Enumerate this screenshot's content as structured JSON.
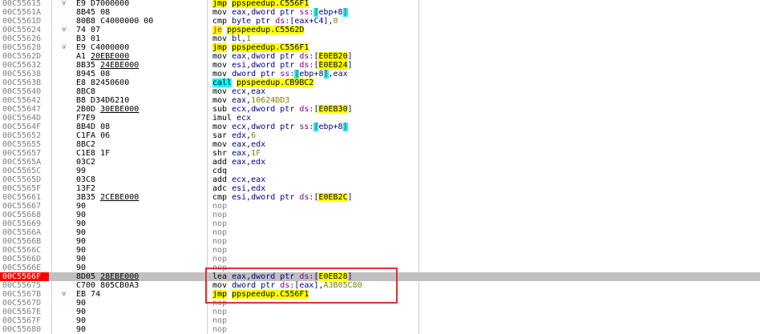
{
  "highlight_color": "#e03030",
  "selected_row_color": "#c0c0c0",
  "rows": [
    {
      "addr": "00C55615",
      "arrow": "v",
      "bytes": [
        {
          "t": "E9 D7000000"
        }
      ],
      "instr": [
        {
          "t": "jmp",
          "c": "mn y"
        },
        {
          "t": " "
        },
        {
          "t": "ppspeedup.C556F1",
          "c": "tgt"
        }
      ]
    },
    {
      "addr": "00C5561A",
      "arrow": "",
      "bytes": [
        {
          "t": "8B45 08"
        }
      ],
      "instr": [
        {
          "t": "mov",
          "c": "mn"
        },
        {
          "t": " eax,dword ptr ",
          "c": "reg"
        },
        {
          "t": "ss:",
          "c": "seg"
        },
        {
          "t": "[",
          "c": "br"
        },
        {
          "t": "ebp+8",
          "c": "reg"
        },
        {
          "t": "]",
          "c": "br"
        }
      ]
    },
    {
      "addr": "00C5561D",
      "arrow": "",
      "bytes": [
        {
          "t": "80B8 C4000000 00"
        }
      ],
      "instr": [
        {
          "t": "cmp",
          "c": "mn"
        },
        {
          "t": " byte ptr ",
          "c": "reg"
        },
        {
          "t": "ds:",
          "c": "seg"
        },
        {
          "t": "[eax+C4]",
          "c": "reg"
        },
        {
          "t": ",",
          "c": "reg"
        },
        {
          "t": "0",
          "c": "imm"
        }
      ]
    },
    {
      "addr": "00C55624",
      "arrow": "v",
      "bytes": [
        {
          "t": "74 07"
        }
      ],
      "instr": [
        {
          "t": "je",
          "c": "mn je"
        },
        {
          "t": " "
        },
        {
          "t": "ppspeedup.C5562D",
          "c": "tgt"
        }
      ]
    },
    {
      "addr": "00C55626",
      "arrow": "",
      "bytes": [
        {
          "t": "B3 01"
        }
      ],
      "instr": [
        {
          "t": "mov",
          "c": "mn"
        },
        {
          "t": " bl,",
          "c": "reg"
        },
        {
          "t": "1",
          "c": "imm"
        }
      ]
    },
    {
      "addr": "00C55628",
      "arrow": "v",
      "bytes": [
        {
          "t": "E9 C4000000"
        }
      ],
      "instr": [
        {
          "t": "jmp",
          "c": "mn y"
        },
        {
          "t": " "
        },
        {
          "t": "ppspeedup.C556F1",
          "c": "tgt"
        }
      ]
    },
    {
      "addr": "00C5562D",
      "arrow": "",
      "bytes": [
        {
          "t": "A1 "
        },
        {
          "t": "20EBE000",
          "c": "u"
        }
      ],
      "instr": [
        {
          "t": "mov",
          "c": "mn"
        },
        {
          "t": " eax,dword ptr ",
          "c": "reg"
        },
        {
          "t": "ds:",
          "c": "seg"
        },
        {
          "t": "[",
          "c": "reg"
        },
        {
          "t": "E0EB20",
          "c": "mem"
        },
        {
          "t": "]",
          "c": "reg"
        }
      ]
    },
    {
      "addr": "00C55632",
      "arrow": "",
      "bytes": [
        {
          "t": "8B35 "
        },
        {
          "t": "24EBE000",
          "c": "u"
        }
      ],
      "instr": [
        {
          "t": "mov",
          "c": "mn"
        },
        {
          "t": " esi,dword ptr ",
          "c": "reg"
        },
        {
          "t": "ds:",
          "c": "seg"
        },
        {
          "t": "[",
          "c": "reg"
        },
        {
          "t": "E0EB24",
          "c": "mem"
        },
        {
          "t": "]",
          "c": "reg"
        }
      ]
    },
    {
      "addr": "00C55638",
      "arrow": "",
      "bytes": [
        {
          "t": "8945 08"
        }
      ],
      "instr": [
        {
          "t": "mov",
          "c": "mn"
        },
        {
          "t": " dword ptr ",
          "c": "reg"
        },
        {
          "t": "ss:",
          "c": "seg"
        },
        {
          "t": "[",
          "c": "br"
        },
        {
          "t": "ebp+8",
          "c": "reg"
        },
        {
          "t": "]",
          "c": "br"
        },
        {
          "t": ",eax",
          "c": "reg"
        }
      ]
    },
    {
      "addr": "00C5563B",
      "arrow": "",
      "bytes": [
        {
          "t": "E8 82450600"
        }
      ],
      "instr": [
        {
          "t": "call",
          "c": "mn c"
        },
        {
          "t": " "
        },
        {
          "t": "ppspeedup.CB9BC2",
          "c": "tgt"
        }
      ]
    },
    {
      "addr": "00C55640",
      "arrow": "",
      "bytes": [
        {
          "t": "8BC8"
        }
      ],
      "instr": [
        {
          "t": "mov",
          "c": "mn"
        },
        {
          "t": " ecx,eax",
          "c": "reg"
        }
      ]
    },
    {
      "addr": "00C55642",
      "arrow": "",
      "bytes": [
        {
          "t": "B8 D34D6210"
        }
      ],
      "instr": [
        {
          "t": "mov",
          "c": "mn"
        },
        {
          "t": " eax,",
          "c": "reg"
        },
        {
          "t": "10624DD3",
          "c": "imm"
        }
      ]
    },
    {
      "addr": "00C55647",
      "arrow": "",
      "bytes": [
        {
          "t": "2B0D "
        },
        {
          "t": "30EBE000",
          "c": "u"
        }
      ],
      "instr": [
        {
          "t": "sub",
          "c": "mn"
        },
        {
          "t": " ecx,dword ptr ",
          "c": "reg"
        },
        {
          "t": "ds:",
          "c": "seg"
        },
        {
          "t": "[",
          "c": "reg"
        },
        {
          "t": "E0EB30",
          "c": "mem"
        },
        {
          "t": "]",
          "c": "reg"
        }
      ]
    },
    {
      "addr": "00C5564D",
      "arrow": "",
      "bytes": [
        {
          "t": "F7E9"
        }
      ],
      "instr": [
        {
          "t": "imul",
          "c": "mn"
        },
        {
          "t": " ecx",
          "c": "reg"
        }
      ]
    },
    {
      "addr": "00C5564F",
      "arrow": "",
      "bytes": [
        {
          "t": "8B4D 08"
        }
      ],
      "instr": [
        {
          "t": "mov",
          "c": "mn"
        },
        {
          "t": " ecx,dword ptr ",
          "c": "reg"
        },
        {
          "t": "ss:",
          "c": "seg"
        },
        {
          "t": "[",
          "c": "br"
        },
        {
          "t": "ebp+8",
          "c": "reg"
        },
        {
          "t": "]",
          "c": "br"
        }
      ]
    },
    {
      "addr": "00C55652",
      "arrow": "",
      "bytes": [
        {
          "t": "C1FA 06"
        }
      ],
      "instr": [
        {
          "t": "sar",
          "c": "mn"
        },
        {
          "t": " edx,",
          "c": "reg"
        },
        {
          "t": "6",
          "c": "imm"
        }
      ]
    },
    {
      "addr": "00C55655",
      "arrow": "",
      "bytes": [
        {
          "t": "8BC2"
        }
      ],
      "instr": [
        {
          "t": "mov",
          "c": "mn"
        },
        {
          "t": " eax,edx",
          "c": "reg"
        }
      ]
    },
    {
      "addr": "00C55657",
      "arrow": "",
      "bytes": [
        {
          "t": "C1E8 1F"
        }
      ],
      "instr": [
        {
          "t": "shr",
          "c": "mn"
        },
        {
          "t": " eax,",
          "c": "reg"
        },
        {
          "t": "1F",
          "c": "imm"
        }
      ]
    },
    {
      "addr": "00C5565A",
      "arrow": "",
      "bytes": [
        {
          "t": "03C2"
        }
      ],
      "instr": [
        {
          "t": "add",
          "c": "mn"
        },
        {
          "t": " eax,edx",
          "c": "reg"
        }
      ]
    },
    {
      "addr": "00C5565C",
      "arrow": "",
      "bytes": [
        {
          "t": "99"
        }
      ],
      "instr": [
        {
          "t": "cdq",
          "c": "mn"
        }
      ]
    },
    {
      "addr": "00C5565D",
      "arrow": "",
      "bytes": [
        {
          "t": "03C8"
        }
      ],
      "instr": [
        {
          "t": "add",
          "c": "mn"
        },
        {
          "t": " ecx,eax",
          "c": "reg"
        }
      ]
    },
    {
      "addr": "00C5565F",
      "arrow": "",
      "bytes": [
        {
          "t": "13F2"
        }
      ],
      "instr": [
        {
          "t": "adc",
          "c": "mn"
        },
        {
          "t": " esi,edx",
          "c": "reg"
        }
      ]
    },
    {
      "addr": "00C55661",
      "arrow": "",
      "bytes": [
        {
          "t": "3B35 "
        },
        {
          "t": "2CEBE000",
          "c": "u"
        }
      ],
      "instr": [
        {
          "t": "cmp",
          "c": "mn"
        },
        {
          "t": " esi,dword ptr ",
          "c": "reg"
        },
        {
          "t": "ds:",
          "c": "seg"
        },
        {
          "t": "[",
          "c": "reg"
        },
        {
          "t": "E0EB2C",
          "c": "mem"
        },
        {
          "t": "]",
          "c": "reg"
        }
      ]
    },
    {
      "addr": "00C55667",
      "arrow": "",
      "bytes": [
        {
          "t": "90"
        }
      ],
      "instr": [
        {
          "t": "nop",
          "c": "nop"
        }
      ]
    },
    {
      "addr": "00C55668",
      "arrow": "",
      "bytes": [
        {
          "t": "90"
        }
      ],
      "instr": [
        {
          "t": "nop",
          "c": "nop"
        }
      ]
    },
    {
      "addr": "00C55669",
      "arrow": "",
      "bytes": [
        {
          "t": "90"
        }
      ],
      "instr": [
        {
          "t": "nop",
          "c": "nop"
        }
      ]
    },
    {
      "addr": "00C5566A",
      "arrow": "",
      "bytes": [
        {
          "t": "90"
        }
      ],
      "instr": [
        {
          "t": "nop",
          "c": "nop"
        }
      ]
    },
    {
      "addr": "00C5566B",
      "arrow": "",
      "bytes": [
        {
          "t": "90"
        }
      ],
      "instr": [
        {
          "t": "nop",
          "c": "nop"
        }
      ]
    },
    {
      "addr": "00C5566C",
      "arrow": "",
      "bytes": [
        {
          "t": "90"
        }
      ],
      "instr": [
        {
          "t": "nop",
          "c": "nop"
        }
      ]
    },
    {
      "addr": "00C5566D",
      "arrow": "",
      "bytes": [
        {
          "t": "90"
        }
      ],
      "instr": [
        {
          "t": "nop",
          "c": "nop"
        }
      ]
    },
    {
      "addr": "00C5566E",
      "arrow": "",
      "bytes": [
        {
          "t": "90"
        }
      ],
      "instr": [
        {
          "t": "nop",
          "c": "nop"
        }
      ]
    },
    {
      "addr": "00C5566F",
      "arrow": "",
      "sel": true,
      "bytes": [
        {
          "t": "8D05 "
        },
        {
          "t": "28EBE000",
          "c": "u"
        }
      ],
      "instr": [
        {
          "t": "lea",
          "c": "mn"
        },
        {
          "t": " eax,dword ptr ",
          "c": "reg"
        },
        {
          "t": "ds:",
          "c": "seg"
        },
        {
          "t": "[",
          "c": "reg"
        },
        {
          "t": "E0EB28",
          "c": "mem"
        },
        {
          "t": "]",
          "c": "reg"
        }
      ]
    },
    {
      "addr": "00C55675",
      "arrow": "",
      "bytes": [
        {
          "t": "C700 805CB0A3"
        }
      ],
      "instr": [
        {
          "t": "mov",
          "c": "mn"
        },
        {
          "t": " dword ptr ",
          "c": "reg"
        },
        {
          "t": "ds:",
          "c": "seg"
        },
        {
          "t": "[eax]",
          "c": "reg"
        },
        {
          "t": ",",
          "c": "reg"
        },
        {
          "t": "A3B05C80",
          "c": "imm"
        }
      ]
    },
    {
      "addr": "00C5567B",
      "arrow": "v",
      "bytes": [
        {
          "t": "EB 74"
        }
      ],
      "instr": [
        {
          "t": "jmp",
          "c": "mn y"
        },
        {
          "t": " "
        },
        {
          "t": "ppspeedup.C556F1",
          "c": "tgt"
        }
      ]
    },
    {
      "addr": "00C5567D",
      "arrow": "",
      "bytes": [
        {
          "t": "90"
        }
      ],
      "instr": [
        {
          "t": "nop",
          "c": "nop"
        }
      ]
    },
    {
      "addr": "00C5567E",
      "arrow": "",
      "bytes": [
        {
          "t": "90"
        }
      ],
      "instr": [
        {
          "t": "nop",
          "c": "nop"
        }
      ]
    },
    {
      "addr": "00C5567F",
      "arrow": "",
      "bytes": [
        {
          "t": "90"
        }
      ],
      "instr": [
        {
          "t": "nop",
          "c": "nop"
        }
      ]
    },
    {
      "addr": "00C55680",
      "arrow": "",
      "bytes": [
        {
          "t": "90"
        }
      ],
      "instr": [
        {
          "t": "nop",
          "c": "nop"
        }
      ]
    }
  ]
}
